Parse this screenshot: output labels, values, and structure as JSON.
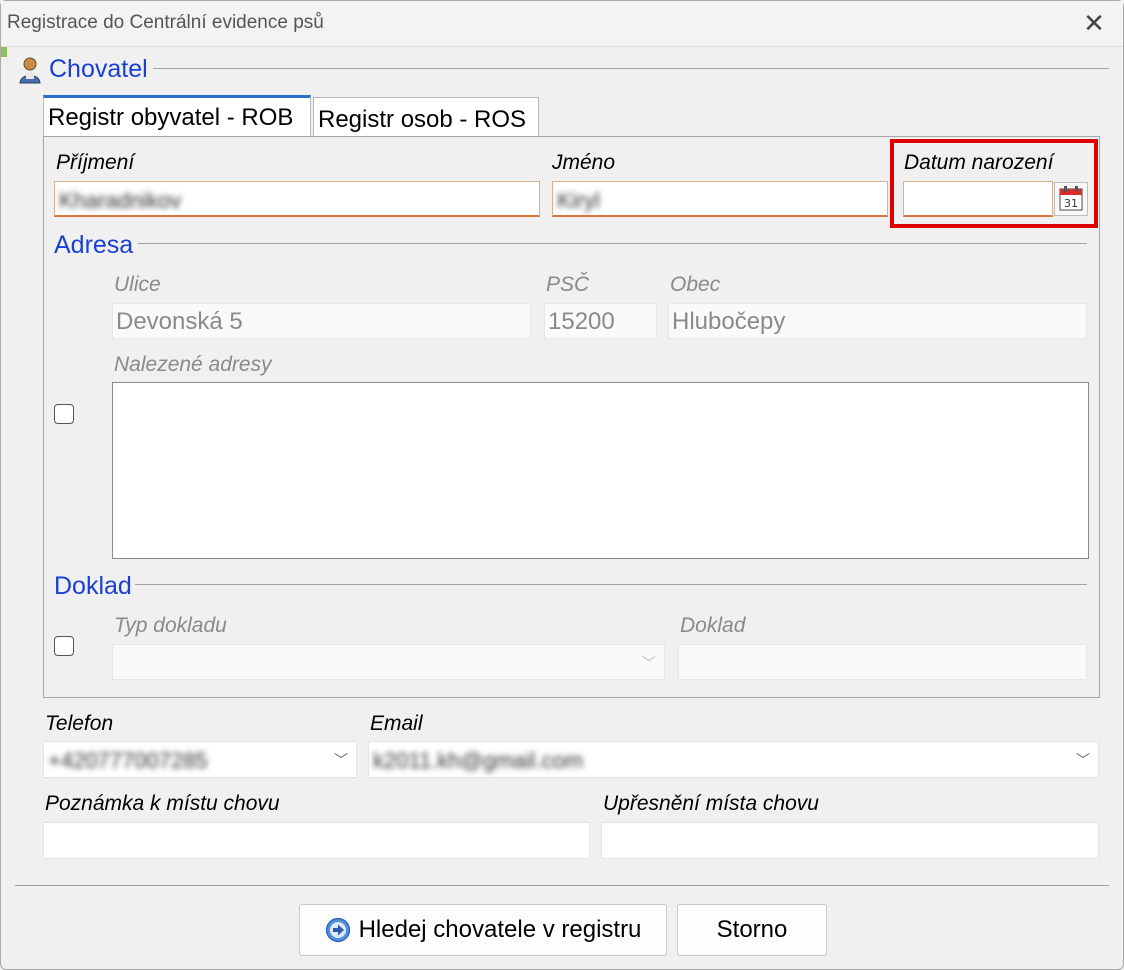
{
  "window": {
    "title": "Registrace do Centrální evidence psů"
  },
  "owner_section": {
    "title": "Chovatel"
  },
  "tabs": [
    {
      "label": "Registr obyvatel - ROB",
      "active": true
    },
    {
      "label": "Registr osob - ROS",
      "active": false
    }
  ],
  "person": {
    "surname_label": "Příjmení",
    "surname_value": "Kharadnikov",
    "first_name_label": "Jméno",
    "first_name_value": "Kiryl",
    "birth_date_label": "Datum narození",
    "birth_date_value": ""
  },
  "address": {
    "title": "Adresa",
    "street_label": "Ulice",
    "street_value": "Devonská 5",
    "zip_label": "PSČ",
    "zip_value": "15200",
    "city_label": "Obec",
    "city_value": "Hlubočepy",
    "found_label": "Nalezené adresy"
  },
  "document": {
    "title": "Doklad",
    "type_label": "Typ dokladu",
    "type_value": "",
    "doc_label": "Doklad",
    "doc_value": ""
  },
  "contact": {
    "phone_label": "Telefon",
    "phone_value": "+420777007285",
    "email_label": "Email",
    "email_value": "k2011.kh@gmail.com"
  },
  "notes": {
    "place_note_label": "Poznámka k místu chovu",
    "place_note_value": "",
    "place_detail_label": "Upřesnění místa chovu",
    "place_detail_value": ""
  },
  "buttons": {
    "search_label": "Hledej chovatele v registru",
    "cancel_label": "Storno"
  },
  "colors": {
    "section_title": "#1a3fd6",
    "highlight": "#e00000",
    "active_tab_accent": "#2b6fc9"
  }
}
